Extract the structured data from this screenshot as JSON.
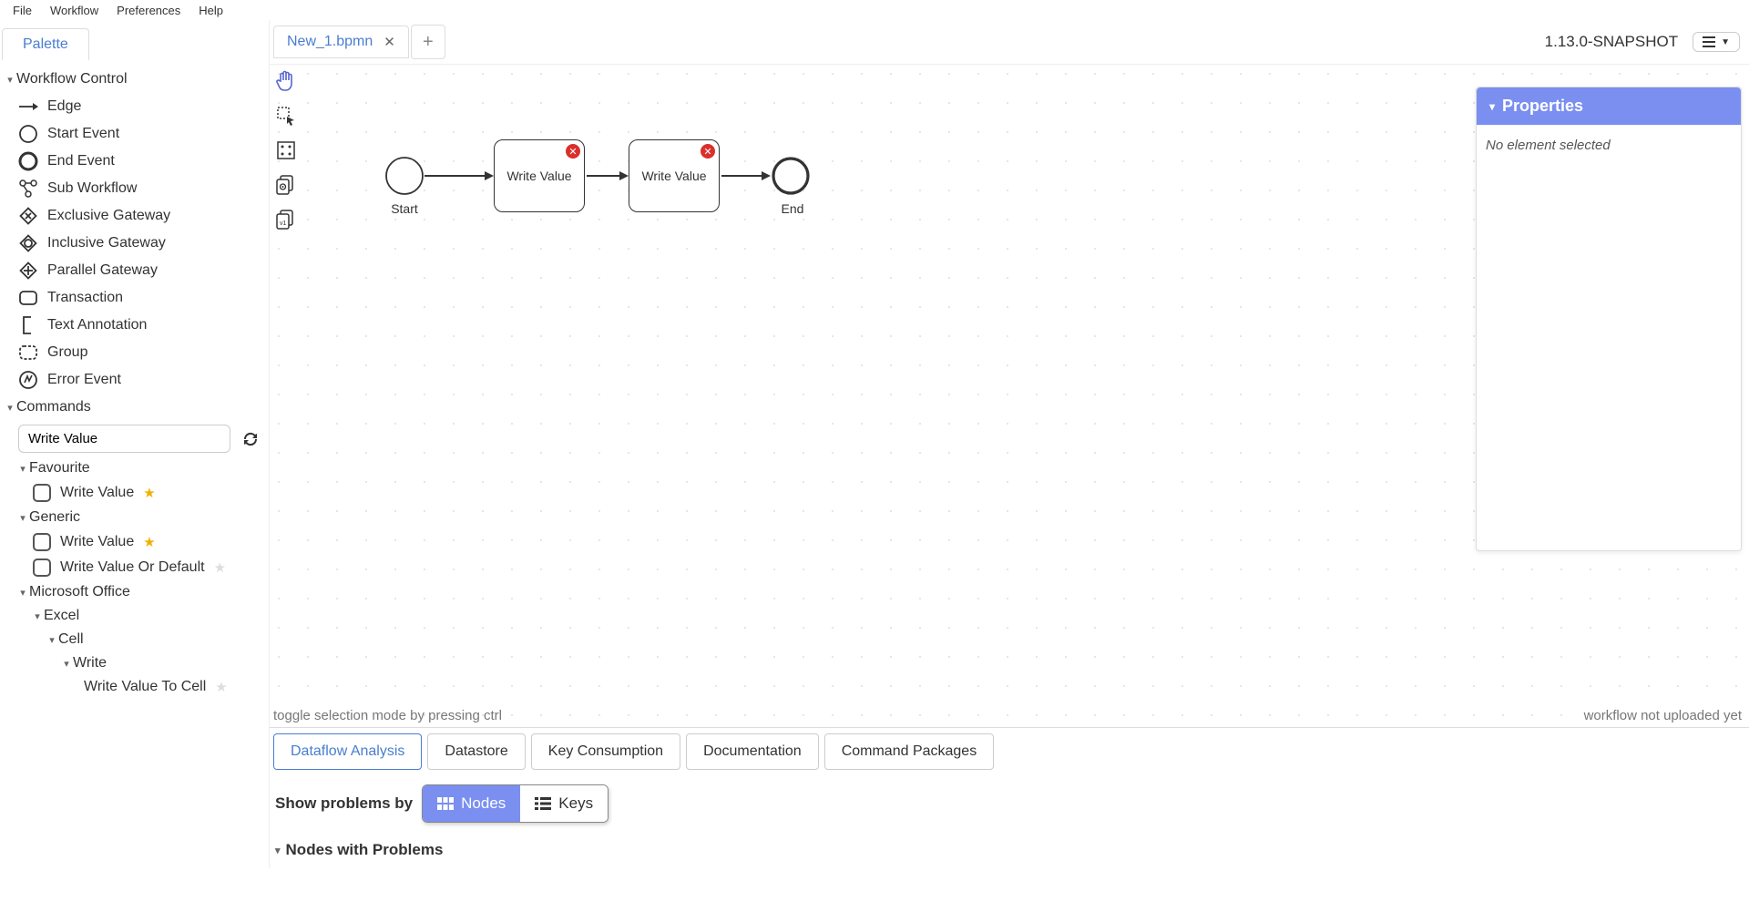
{
  "menubar": {
    "items": [
      "File",
      "Workflow",
      "Preferences",
      "Help"
    ]
  },
  "paletteTabLabel": "Palette",
  "sidebar": {
    "workflowControl": {
      "title": "Workflow Control",
      "items": [
        "Edge",
        "Start Event",
        "End Event",
        "Sub Workflow",
        "Exclusive Gateway",
        "Inclusive Gateway",
        "Parallel Gateway",
        "Transaction",
        "Text Annotation",
        "Group",
        "Error Event"
      ]
    },
    "commands": {
      "title": "Commands",
      "filterValue": "Write Value",
      "groups": {
        "favourite": {
          "title": "Favourite",
          "items": [
            {
              "label": "Write Value",
              "fav": true
            }
          ]
        },
        "generic": {
          "title": "Generic",
          "items": [
            {
              "label": "Write Value",
              "fav": true
            },
            {
              "label": "Write Value Or Default",
              "fav": false
            }
          ]
        },
        "office": {
          "title": "Microsoft Office",
          "excelLabel": "Excel",
          "cellLabel": "Cell",
          "writeLabel": "Write",
          "item": {
            "label": "Write Value To Cell",
            "fav": false
          }
        }
      }
    }
  },
  "tabs": {
    "file": "New_1.bpmn"
  },
  "version": "1.13.0-SNAPSHOT",
  "canvas": {
    "startLabel": "Start",
    "endLabel": "End",
    "task1": "Write Value",
    "task2": "Write Value",
    "hint": "toggle selection mode by pressing ctrl",
    "uploadStatus": "workflow not uploaded yet"
  },
  "properties": {
    "title": "Properties",
    "body": "No element selected"
  },
  "bottom": {
    "tabs": [
      "Dataflow Analysis",
      "Datastore",
      "Key Consumption",
      "Documentation",
      "Command Packages"
    ],
    "problemsBy": "Show problems by",
    "nodesBtn": "Nodes",
    "keysBtn": "Keys",
    "sectionTitle": "Nodes with Problems"
  }
}
